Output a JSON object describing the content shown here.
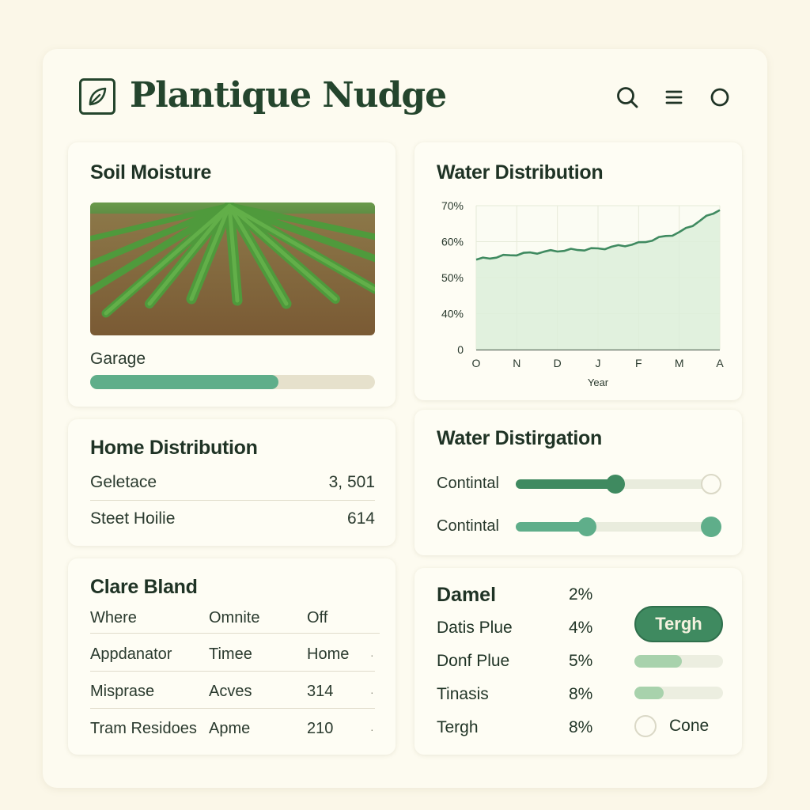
{
  "app": {
    "title": "Plantique Nudge"
  },
  "header_icons": [
    "search-icon",
    "menu-icon",
    "circle-icon"
  ],
  "soil_moisture": {
    "title": "Soil Moisture",
    "label": "Garage",
    "progress": 0.66
  },
  "water_distribution": {
    "title": "Water Distribution"
  },
  "chart_data": {
    "type": "area",
    "title": "Water Distribution",
    "xlabel": "Year",
    "ylabel": "",
    "x": [
      "O",
      "N",
      "D",
      "J",
      "F",
      "M",
      "A"
    ],
    "y_tick_labels": [
      "0",
      "40%",
      "50%",
      "60%",
      "70%"
    ],
    "ylim": [
      30,
      70
    ],
    "series": [
      {
        "values": [
          55,
          56.5,
          57.5,
          58,
          59.5,
          62.5,
          69
        ]
      }
    ],
    "grid": true,
    "color": "#3f8a60"
  },
  "home_distribution": {
    "title": "Home Distribution",
    "rows": [
      {
        "label": "Geletace",
        "value": "3, 501"
      },
      {
        "label": "Steet Hoilie",
        "value": "614"
      }
    ]
  },
  "water_distirgation": {
    "title": "Water Distirgation",
    "sliders": [
      {
        "label": "Contintal",
        "value": 0.49
      },
      {
        "label": "Contintal",
        "value": 0.35
      }
    ]
  },
  "clare_bland": {
    "title": "Clare Bland",
    "headers": [
      "Where",
      "Omnite",
      "Off"
    ],
    "rows": [
      [
        "Appdanator",
        "Timee",
        "Home"
      ],
      [
        "Misprase",
        "Acves",
        "314"
      ],
      [
        "Tram Residoes",
        "Apme",
        "210"
      ]
    ]
  },
  "percent_list": {
    "rows": [
      {
        "label": "Damel",
        "value": "2%"
      },
      {
        "label": "Datis Plue",
        "value": "4%"
      },
      {
        "label": "Donf Plue",
        "value": "5%"
      },
      {
        "label": "Tinasis",
        "value": "8%"
      },
      {
        "label": "Tergh",
        "value": "8%"
      }
    ],
    "button_label": "Tergh",
    "bar_1": 0.54,
    "bar_2": 0.33,
    "radio_label": "Cone"
  },
  "colors": {
    "accent": "#3f8a60",
    "accent_light": "#5fae8a",
    "background": "#fbf7e8"
  }
}
